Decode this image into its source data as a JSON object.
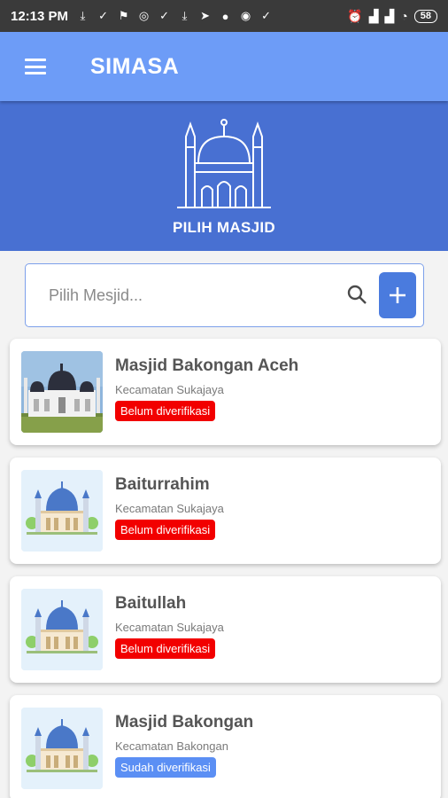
{
  "status_bar": {
    "time": "12:13 PM",
    "notification_icons": [
      "download-icon",
      "check-icon",
      "flag-icon",
      "instagram-icon",
      "check-icon",
      "download-icon",
      "telegram-icon",
      "chat-icon",
      "whatsapp-icon",
      "check-icon"
    ],
    "right_icons": [
      "alarm-icon",
      "signal-icon",
      "signal-icon",
      "wifi-icon"
    ],
    "battery": "58"
  },
  "app_bar": {
    "title": "SIMASA",
    "menu_icon": "hamburger-menu-icon"
  },
  "hero": {
    "title": "PILIH MASJID",
    "icon": "mosque-outline-icon"
  },
  "search": {
    "placeholder": "Pilih Mesjid...",
    "value": "",
    "add_icon": "plus-icon"
  },
  "colors": {
    "app_bar": "#6d9cf7",
    "hero": "#4870d2",
    "unverified": "#f20000",
    "verified": "#5b8ff4"
  },
  "mosques": [
    {
      "name": "Masjid Bakongan Aceh",
      "district": "Kecamatan Sukajaya",
      "status": "Belum diverifikasi",
      "verified": false,
      "image": "photo"
    },
    {
      "name": "Baiturrahim",
      "district": "Kecamatan Sukajaya",
      "status": "Belum diverifikasi",
      "verified": false,
      "image": "illustration"
    },
    {
      "name": "Baitullah",
      "district": "Kecamatan Sukajaya",
      "status": "Belum diverifikasi",
      "verified": false,
      "image": "illustration"
    },
    {
      "name": "Masjid Bakongan",
      "district": "Kecamatan Bakongan",
      "status": "Sudah diverifikasi",
      "verified": true,
      "image": "illustration"
    }
  ]
}
